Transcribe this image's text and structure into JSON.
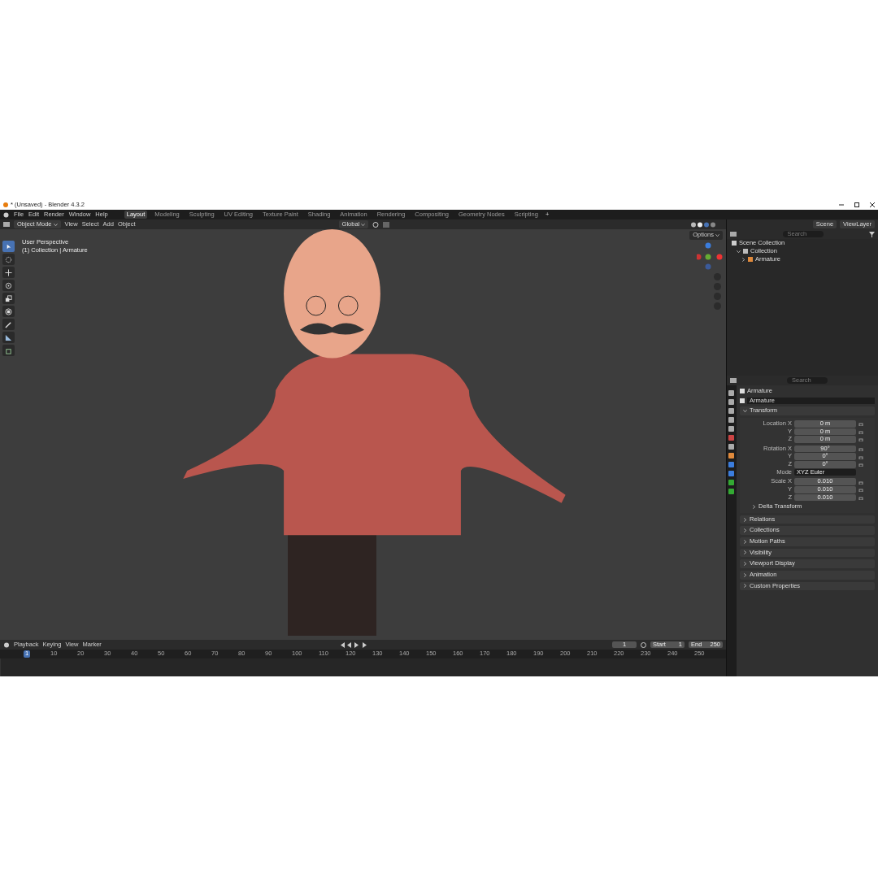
{
  "window": {
    "title": "* (Unsaved) - Blender 4.3.2"
  },
  "menu": [
    "File",
    "Edit",
    "Render",
    "Window",
    "Help"
  ],
  "workspaces": [
    {
      "label": "Layout",
      "selected": true
    },
    {
      "label": "Modeling",
      "selected": false
    },
    {
      "label": "Sculpting",
      "selected": false
    },
    {
      "label": "UV Editing",
      "selected": false
    },
    {
      "label": "Texture Paint",
      "selected": false
    },
    {
      "label": "Shading",
      "selected": false
    },
    {
      "label": "Animation",
      "selected": false
    },
    {
      "label": "Rendering",
      "selected": false
    },
    {
      "label": "Compositing",
      "selected": false
    },
    {
      "label": "Geometry Nodes",
      "selected": false
    },
    {
      "label": "Scripting",
      "selected": false
    }
  ],
  "add_workspace": "+",
  "viewport_header": {
    "mode": "Object Mode",
    "menus": [
      "View",
      "Select",
      "Add",
      "Object"
    ],
    "orientation": "Global",
    "options": "Options"
  },
  "viewport": {
    "overlay_lines": [
      "User Perspective",
      "(1) Collection | Armature"
    ]
  },
  "tools": [
    {
      "kind": "select",
      "selected": true
    },
    {
      "kind": "cursor",
      "selected": false
    },
    {
      "kind": "move",
      "selected": false
    },
    {
      "kind": "rotate",
      "selected": false
    },
    {
      "kind": "scale",
      "selected": false
    },
    {
      "kind": "transform",
      "selected": false
    },
    {
      "kind": "annotate",
      "selected": false
    },
    {
      "kind": "measure",
      "selected": false
    },
    {
      "kind": "add-cube",
      "selected": false
    }
  ],
  "outliner": {
    "scene": "Scene",
    "view_layer": "ViewLayer",
    "search_placeholder": "Search",
    "tree": [
      {
        "label": "Scene Collection",
        "kind": "scene",
        "children": [
          {
            "label": "Collection",
            "kind": "collection",
            "expanded": true,
            "children": [
              {
                "label": "Armature",
                "kind": "armature",
                "expanded": false
              }
            ]
          }
        ]
      }
    ]
  },
  "properties": {
    "search_placeholder": "Search",
    "object_name": "Armature",
    "data_name": "Armature",
    "transform": {
      "label": "Transform",
      "expanded": true,
      "groups": [
        [
          {
            "label": "Location X",
            "value": "0 m",
            "kind": "number"
          },
          {
            "label": "Y",
            "value": "0 m",
            "kind": "number"
          },
          {
            "label": "Z",
            "value": "0 m",
            "kind": "number"
          }
        ],
        [
          {
            "label": "Rotation X",
            "value": "90°",
            "kind": "number"
          },
          {
            "label": "Y",
            "value": "0°",
            "kind": "number"
          },
          {
            "label": "Z",
            "value": "0°",
            "kind": "number"
          },
          {
            "label": "Mode",
            "value": "XYZ Euler",
            "kind": "select"
          }
        ],
        [
          {
            "label": "Scale X",
            "value": "0.010",
            "kind": "number"
          },
          {
            "label": "Y",
            "value": "0.010",
            "kind": "number"
          },
          {
            "label": "Z",
            "value": "0.010",
            "kind": "number"
          }
        ]
      ],
      "subpanel": "Delta Transform"
    },
    "panels": [
      "Relations",
      "Collections",
      "Motion Paths",
      "Visibility",
      "Viewport Display",
      "Animation",
      "Custom Properties"
    ]
  },
  "timeline": {
    "menus": [
      "Playback",
      "Keying",
      "View",
      "Marker"
    ],
    "current_frame": "1",
    "start_label": "Start",
    "start": "1",
    "end_label": "End",
    "end": "250",
    "ticks": [
      "1",
      "10",
      "20",
      "30",
      "40",
      "50",
      "60",
      "70",
      "80",
      "90",
      "100",
      "110",
      "120",
      "130",
      "140",
      "150",
      "160",
      "170",
      "180",
      "190",
      "200",
      "210",
      "220",
      "230",
      "240",
      "250"
    ]
  }
}
